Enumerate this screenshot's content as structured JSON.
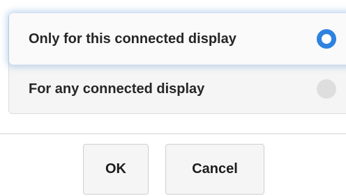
{
  "options": [
    {
      "label": "Only for this connected display",
      "selected": true
    },
    {
      "label": "For any connected display",
      "selected": false
    }
  ],
  "buttons": {
    "ok_label": "OK",
    "cancel_label": "Cancel"
  },
  "colors": {
    "accent": "#2e82e0",
    "selected_glow": "#6ea0dc",
    "unchecked_radio": "#dedede"
  }
}
